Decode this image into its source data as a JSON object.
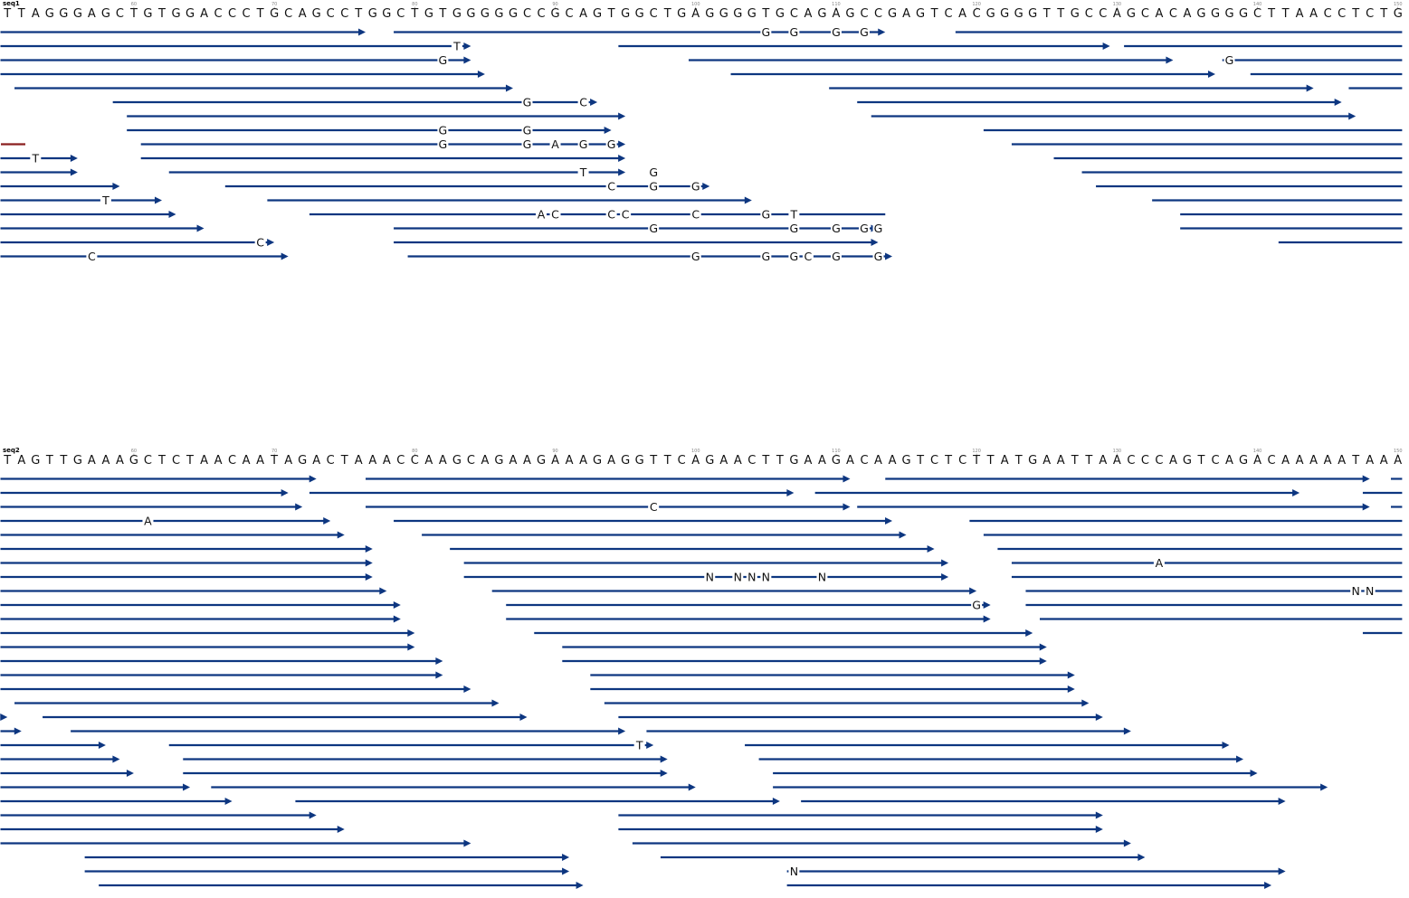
{
  "colors": {
    "read": "#0d3680",
    "text": "#111111",
    "tick": "#888888",
    "marker": "#8a1f1f"
  },
  "panels": [
    {
      "name": "seq1",
      "label": "seq1",
      "start": 50,
      "ticks": [
        60,
        70,
        80,
        90,
        100,
        110,
        120,
        130,
        140,
        150
      ],
      "sequence": "TTAGGGAGCTGTGGACCCTGCAGCCTGGCTGTGGGGGCCGCAGTGGCTGAGGGGTGCAGAGCCGAGTCACGGGGTTGCCAGCACAGGGGCTTAACCTCTG",
      "rows": [
        [
          [
            50,
            76,
            1
          ],
          [
            78,
            113,
            1
          ],
          [
            118,
            149.8,
            0
          ]
        ],
        [
          [
            50,
            83.5,
            1
          ],
          [
            94,
            129,
            1
          ],
          [
            130,
            149.8,
            0
          ]
        ],
        [
          [
            50,
            83.5,
            1
          ],
          [
            99,
            133.5,
            1
          ],
          [
            137,
            149.8,
            0
          ]
        ],
        [
          [
            50,
            84.5,
            1
          ],
          [
            102,
            136.5,
            1
          ],
          [
            139,
            149.8,
            0
          ]
        ],
        [
          [
            51,
            86.5,
            1
          ],
          [
            109,
            143.5,
            1
          ],
          [
            146,
            149.8,
            0
          ]
        ],
        [
          [
            58,
            92.5,
            1
          ],
          [
            111,
            145.5,
            1
          ]
        ],
        [
          [
            59,
            94.5,
            1
          ],
          [
            112,
            146.5,
            1
          ]
        ],
        [
          [
            59,
            93.5,
            1
          ],
          [
            120,
            149.8,
            0
          ]
        ],
        [
          [
            60,
            94.5,
            1
          ],
          [
            122,
            149.8,
            0
          ]
        ],
        [
          [
            50,
            55.5,
            1
          ],
          [
            60,
            94.5,
            1
          ],
          [
            125,
            149.8,
            0
          ]
        ],
        [
          [
            50,
            55.5,
            1
          ],
          [
            62,
            94.5,
            1
          ],
          [
            127,
            149.8,
            0
          ]
        ],
        [
          [
            50,
            58.5,
            1
          ],
          [
            66,
            100.5,
            1
          ],
          [
            128,
            149.8,
            0
          ]
        ],
        [
          [
            50,
            61.5,
            1
          ],
          [
            69,
            103.5,
            1
          ],
          [
            132,
            149.8,
            0
          ]
        ],
        [
          [
            50,
            62.5,
            1
          ],
          [
            72,
            113,
            0
          ],
          [
            134,
            149.8,
            0
          ]
        ],
        [
          [
            50,
            64.5,
            1
          ],
          [
            78,
            112.5,
            1
          ],
          [
            134,
            149.8,
            0
          ]
        ],
        [
          [
            50,
            69.5,
            1
          ],
          [
            78,
            112.5,
            1
          ],
          [
            141,
            149.8,
            0
          ]
        ],
        [
          [
            50,
            70.5,
            1
          ],
          [
            79,
            113.5,
            1
          ]
        ]
      ],
      "mismatches": [
        [
          0,
          104.5,
          "G"
        ],
        [
          0,
          106.5,
          "G"
        ],
        [
          0,
          109.5,
          "G"
        ],
        [
          0,
          111.5,
          "G"
        ],
        [
          1,
          82.5,
          "T"
        ],
        [
          2,
          81.5,
          "G"
        ],
        [
          2,
          137.5,
          "G"
        ],
        [
          5,
          87.5,
          "G"
        ],
        [
          5,
          91.5,
          "C"
        ],
        [
          7,
          81.5,
          "G"
        ],
        [
          7,
          87.5,
          "G"
        ],
        [
          8,
          81.5,
          "G"
        ],
        [
          8,
          87.5,
          "G"
        ],
        [
          8,
          89.5,
          "A"
        ],
        [
          8,
          91.5,
          "G"
        ],
        [
          8,
          93.5,
          "G"
        ],
        [
          9,
          52.5,
          "T"
        ],
        [
          10,
          91.5,
          "T"
        ],
        [
          10,
          96.5,
          "G"
        ],
        [
          11,
          93.5,
          "C"
        ],
        [
          11,
          96.5,
          "G"
        ],
        [
          11,
          99.5,
          "G"
        ],
        [
          12,
          57.5,
          "T"
        ],
        [
          13,
          88.5,
          "A"
        ],
        [
          13,
          89.5,
          "C"
        ],
        [
          13,
          93.5,
          "C"
        ],
        [
          13,
          94.5,
          "C"
        ],
        [
          13,
          99.5,
          "C"
        ],
        [
          13,
          104.5,
          "G"
        ],
        [
          13,
          106.5,
          "T"
        ],
        [
          14,
          96.5,
          "G"
        ],
        [
          14,
          106.5,
          "G"
        ],
        [
          14,
          109.5,
          "G"
        ],
        [
          14,
          111.5,
          "G"
        ],
        [
          14,
          112.5,
          "G"
        ],
        [
          15,
          68.5,
          "C"
        ],
        [
          16,
          56.5,
          "C"
        ],
        [
          16,
          99.5,
          "G"
        ],
        [
          16,
          104.5,
          "G"
        ],
        [
          16,
          106.5,
          "G"
        ],
        [
          16,
          107.5,
          "C"
        ],
        [
          16,
          109.5,
          "G"
        ],
        [
          16,
          112.5,
          "G"
        ]
      ]
    },
    {
      "name": "seq2",
      "label": "seq2",
      "start": 50,
      "ticks": [
        60,
        70,
        80,
        90,
        100,
        110,
        120,
        130,
        140,
        150
      ],
      "sequence": "TAGTTGAAAGCTCTAACAATAGACTAAACCAAGCAGAAGAAAGAGGTTCAGAACTTGAAGACAAGTCTCTTATGAATTAACCCAGTCAGACAAAAATAAA",
      "rows": [
        [
          [
            50,
            72.5,
            1
          ],
          [
            76,
            110.5,
            1
          ],
          [
            113,
            147.5,
            1
          ],
          [
            149,
            149.8,
            0
          ]
        ],
        [
          [
            50,
            70.5,
            1
          ],
          [
            72,
            106.5,
            1
          ],
          [
            108,
            142.5,
            1
          ],
          [
            147,
            149.8,
            0
          ]
        ],
        [
          [
            50,
            71.5,
            1
          ],
          [
            76,
            110.5,
            1
          ],
          [
            111,
            147.5,
            1
          ],
          [
            149,
            149.8,
            0
          ]
        ],
        [
          [
            50,
            73.5,
            1
          ],
          [
            78,
            113.5,
            1
          ],
          [
            119,
            149.8,
            0
          ]
        ],
        [
          [
            50,
            74.5,
            1
          ],
          [
            80,
            114.5,
            1
          ],
          [
            120,
            149.8,
            0
          ]
        ],
        [
          [
            50,
            76.5,
            1
          ],
          [
            82,
            116.5,
            1
          ],
          [
            121,
            149.8,
            0
          ]
        ],
        [
          [
            50,
            76.5,
            1
          ],
          [
            83,
            117.5,
            1
          ],
          [
            122,
            149.8,
            0
          ]
        ],
        [
          [
            50,
            76.5,
            1
          ],
          [
            83,
            117.5,
            1
          ],
          [
            122,
            149.8,
            0
          ]
        ],
        [
          [
            50,
            77.5,
            1
          ],
          [
            85,
            119.5,
            1
          ],
          [
            123,
            149.8,
            0
          ]
        ],
        [
          [
            50,
            78.5,
            1
          ],
          [
            86,
            120.5,
            1
          ],
          [
            123,
            149.8,
            0
          ]
        ],
        [
          [
            50,
            78.5,
            1
          ],
          [
            86,
            120.5,
            1
          ],
          [
            124,
            149.8,
            0
          ]
        ],
        [
          [
            50,
            79.5,
            1
          ],
          [
            88,
            123.5,
            1
          ],
          [
            147,
            149.8,
            0
          ]
        ],
        [
          [
            50,
            79.5,
            1
          ],
          [
            90,
            124.5,
            1
          ]
        ],
        [
          [
            50,
            81.5,
            1
          ],
          [
            90,
            124.5,
            1
          ]
        ],
        [
          [
            50,
            81.5,
            1
          ],
          [
            92,
            126.5,
            1
          ]
        ],
        [
          [
            50,
            83.5,
            1
          ],
          [
            92,
            126.5,
            1
          ]
        ],
        [
          [
            51,
            85.5,
            1
          ],
          [
            93,
            127.5,
            1
          ]
        ],
        [
          [
            50,
            50.5,
            1
          ],
          [
            53,
            87.5,
            1
          ],
          [
            94,
            128.5,
            1
          ]
        ],
        [
          [
            50,
            51.5,
            1
          ],
          [
            55,
            94.5,
            1
          ],
          [
            96,
            130.5,
            1
          ]
        ],
        [
          [
            50,
            57.5,
            1
          ],
          [
            62,
            96.5,
            1
          ],
          [
            103,
            137.5,
            1
          ]
        ],
        [
          [
            50,
            58.5,
            1
          ],
          [
            63,
            97.5,
            1
          ],
          [
            104,
            138.5,
            1
          ]
        ],
        [
          [
            50,
            59.5,
            1
          ],
          [
            63,
            97.5,
            1
          ],
          [
            105,
            139.5,
            1
          ]
        ],
        [
          [
            50,
            63.5,
            1
          ],
          [
            65,
            99.5,
            1
          ],
          [
            105,
            144.5,
            1
          ]
        ],
        [
          [
            50,
            66.5,
            1
          ],
          [
            71,
            105.5,
            1
          ],
          [
            107,
            141.5,
            1
          ]
        ],
        [
          [
            50,
            72.5,
            1
          ],
          [
            94,
            128.5,
            1
          ]
        ],
        [
          [
            50,
            74.5,
            1
          ],
          [
            94,
            128.5,
            1
          ]
        ],
        [
          [
            50,
            83.5,
            1
          ],
          [
            95,
            130.5,
            1
          ]
        ],
        [
          [
            56,
            90.5,
            1
          ],
          [
            97,
            131.5,
            1
          ]
        ],
        [
          [
            56,
            90.5,
            1
          ],
          [
            106,
            141.5,
            1
          ]
        ],
        [
          [
            57,
            91.5,
            1
          ],
          [
            106,
            140.5,
            1
          ]
        ]
      ],
      "mismatches": [
        [
          2,
          96.5,
          "C"
        ],
        [
          3,
          60.5,
          "A"
        ],
        [
          6,
          132.5,
          "A"
        ],
        [
          7,
          100.5,
          "N"
        ],
        [
          7,
          102.5,
          "N"
        ],
        [
          7,
          103.5,
          "N"
        ],
        [
          7,
          104.5,
          "N"
        ],
        [
          7,
          108.5,
          "N"
        ],
        [
          8,
          146.5,
          "N"
        ],
        [
          8,
          147.5,
          "N"
        ],
        [
          9,
          119.5,
          "G"
        ],
        [
          19,
          95.5,
          "T"
        ],
        [
          28,
          106.5,
          "N"
        ]
      ]
    }
  ]
}
